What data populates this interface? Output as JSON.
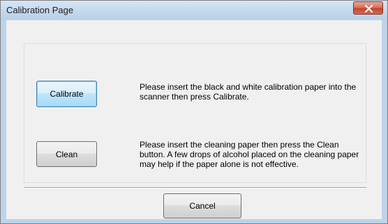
{
  "window": {
    "title": "Calibration Page"
  },
  "calibrate": {
    "button_label": "Calibrate",
    "description_line1": "Please insert the black and white calibration paper into the",
    "description_line2": "scanner then press Calibrate."
  },
  "clean": {
    "button_label": "Clean",
    "description_line1": "Please insert the cleaning paper then press the Clean",
    "description_line2": "button. A few drops of alcohol placed on the cleaning paper",
    "description_line3": "may help if the paper alone is not effective."
  },
  "footer": {
    "cancel_label": "Cancel"
  },
  "icons": {
    "close": "close-icon"
  },
  "colors": {
    "title_bar": "#c5d9ee",
    "client_background": "#f0f0f0",
    "close_button": "#c5442c",
    "focused_button_border": "#3c7fb1"
  }
}
